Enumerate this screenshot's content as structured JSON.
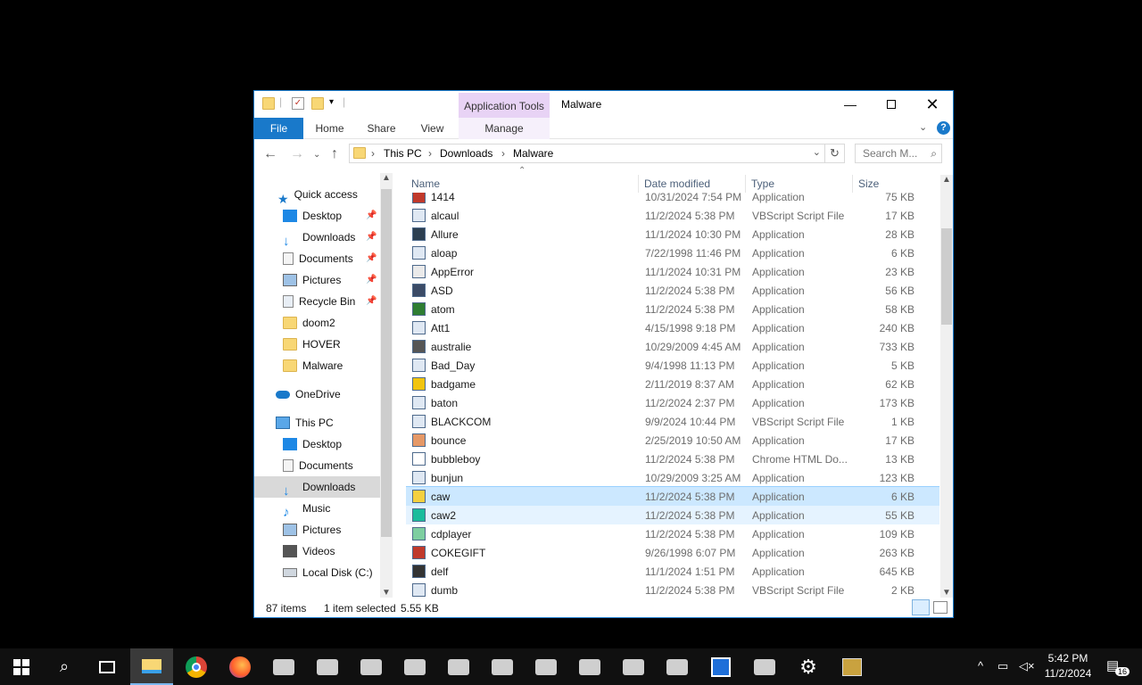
{
  "window": {
    "title": "Malware",
    "contextual_tab_group": "Application Tools",
    "tabs": [
      "File",
      "Home",
      "Share",
      "View",
      "Manage"
    ]
  },
  "address": {
    "crumbs": [
      "This PC",
      "Downloads",
      "Malware"
    ],
    "search_placeholder": "Search M..."
  },
  "nav": {
    "quick_access": "Quick access",
    "quick_items": [
      "Desktop",
      "Downloads",
      "Documents",
      "Pictures",
      "Recycle Bin",
      "doom2",
      "HOVER",
      "Malware"
    ],
    "onedrive": "OneDrive",
    "this_pc": "This PC",
    "pc_items": [
      "Desktop",
      "Documents",
      "Downloads",
      "Music",
      "Pictures",
      "Videos",
      "Local Disk (C:)"
    ]
  },
  "columns": {
    "name": "Name",
    "date": "Date modified",
    "type": "Type",
    "size": "Size"
  },
  "files": [
    {
      "name": "1414",
      "date": "10/31/2024 7:54 PM",
      "type": "Application",
      "size": "75 KB"
    },
    {
      "name": "alcaul",
      "date": "11/2/2024 5:38 PM",
      "type": "VBScript Script File",
      "size": "17 KB"
    },
    {
      "name": "Allure",
      "date": "11/1/2024 10:30 PM",
      "type": "Application",
      "size": "28 KB"
    },
    {
      "name": "aloap",
      "date": "7/22/1998 11:46 PM",
      "type": "Application",
      "size": "6 KB"
    },
    {
      "name": "AppError",
      "date": "11/1/2024 10:31 PM",
      "type": "Application",
      "size": "23 KB"
    },
    {
      "name": "ASD",
      "date": "11/2/2024 5:38 PM",
      "type": "Application",
      "size": "56 KB"
    },
    {
      "name": "atom",
      "date": "11/2/2024 5:38 PM",
      "type": "Application",
      "size": "58 KB"
    },
    {
      "name": "Att1",
      "date": "4/15/1998 9:18 PM",
      "type": "Application",
      "size": "240 KB"
    },
    {
      "name": "australie",
      "date": "10/29/2009 4:45 AM",
      "type": "Application",
      "size": "733 KB"
    },
    {
      "name": "Bad_Day",
      "date": "9/4/1998 11:13 PM",
      "type": "Application",
      "size": "5 KB"
    },
    {
      "name": "badgame",
      "date": "2/11/2019 8:37 AM",
      "type": "Application",
      "size": "62 KB"
    },
    {
      "name": "baton",
      "date": "11/2/2024 2:37 PM",
      "type": "Application",
      "size": "173 KB"
    },
    {
      "name": "BLACKCOM",
      "date": "9/9/2024 10:44 PM",
      "type": "VBScript Script File",
      "size": "1 KB"
    },
    {
      "name": "bounce",
      "date": "2/25/2019 10:50 AM",
      "type": "Application",
      "size": "17 KB"
    },
    {
      "name": "bubbleboy",
      "date": "11/2/2024 5:38 PM",
      "type": "Chrome HTML Do...",
      "size": "13 KB"
    },
    {
      "name": "bunjun",
      "date": "10/29/2009 3:25 AM",
      "type": "Application",
      "size": "123 KB"
    },
    {
      "name": "caw",
      "date": "11/2/2024 5:38 PM",
      "type": "Application",
      "size": "6 KB"
    },
    {
      "name": "caw2",
      "date": "11/2/2024 5:38 PM",
      "type": "Application",
      "size": "55 KB"
    },
    {
      "name": "cdplayer",
      "date": "11/2/2024 5:38 PM",
      "type": "Application",
      "size": "109 KB"
    },
    {
      "name": "COKEGIFT",
      "date": "9/26/1998 6:07 PM",
      "type": "Application",
      "size": "263 KB"
    },
    {
      "name": "delf",
      "date": "11/1/2024 1:51 PM",
      "type": "Application",
      "size": "645 KB"
    },
    {
      "name": "dumb",
      "date": "11/2/2024 5:38 PM",
      "type": "VBScript Script File",
      "size": "2 KB"
    }
  ],
  "status": {
    "count": "87 items",
    "selection": "1 item selected",
    "sel_size": "5.55 KB"
  },
  "clock": {
    "time": "5:42 PM",
    "date": "11/2/2024"
  },
  "notif_count": "16"
}
